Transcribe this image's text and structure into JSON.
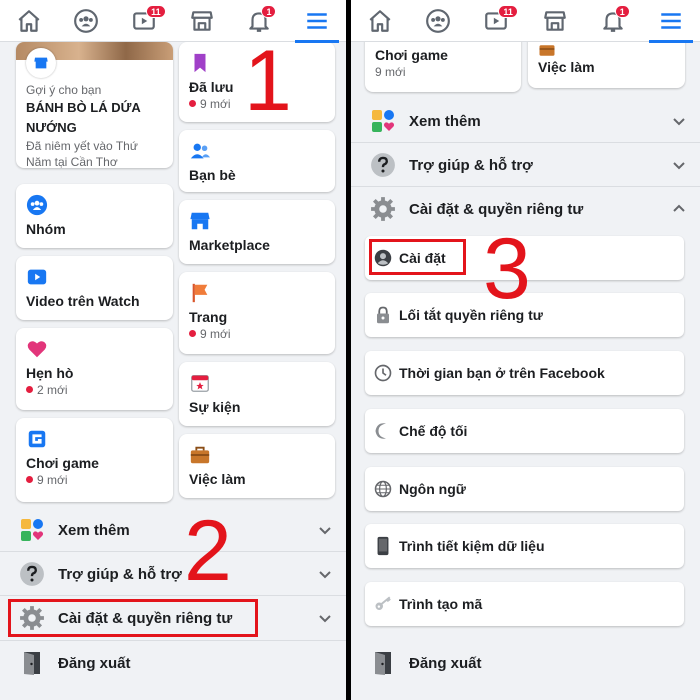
{
  "colors": {
    "accent": "#1877f2",
    "badge": "#e41e3f",
    "annotation": "#e3141b"
  },
  "nav": {
    "items": [
      {
        "icon": "home-icon"
      },
      {
        "icon": "groups-icon"
      },
      {
        "icon": "watch-icon",
        "badge": "11"
      },
      {
        "icon": "marketplace-icon"
      },
      {
        "icon": "bell-icon",
        "badge": "1"
      },
      {
        "icon": "menu-icon",
        "active": true
      }
    ]
  },
  "left": {
    "suggest": {
      "label": "Gợi ý cho bạn",
      "title": "BÁNH BÒ LÁ DỨA NƯỚNG",
      "desc": "Đã niêm yết vào Thứ Năm tại Cần Thơ"
    },
    "col_left": [
      {
        "title": "Nhóm",
        "icon": "groups-icon"
      },
      {
        "title": "Video trên Watch",
        "icon": "watch-icon"
      },
      {
        "title": "Hẹn hò",
        "sub": "2 mới",
        "icon": "heart-icon"
      },
      {
        "title": "Chơi game",
        "sub": "9 mới",
        "icon": "gaming-icon"
      }
    ],
    "col_right": [
      {
        "title": "Đã lưu",
        "sub": "9 mới",
        "icon": "bookmark-icon"
      },
      {
        "title": "Bạn bè",
        "icon": "friends-icon"
      },
      {
        "title": "Marketplace",
        "icon": "marketplace-icon"
      },
      {
        "title": "Trang",
        "sub": "9 mới",
        "icon": "flag-icon"
      },
      {
        "title": "Sự kiện",
        "icon": "calendar-icon"
      },
      {
        "title": "Việc làm",
        "icon": "briefcase-icon"
      }
    ],
    "rows": {
      "see_more": "Xem thêm",
      "help": "Trợ giúp & hỗ trợ",
      "settings": "Cài đặt & quyền riêng tư",
      "logout": "Đăng xuất"
    }
  },
  "right": {
    "top_cards": [
      {
        "title": "Chơi game",
        "sub": "9 mới"
      },
      {
        "title": "Việc làm"
      }
    ],
    "rows": {
      "see_more": "Xem thêm",
      "help": "Trợ giúp & hỗ trợ",
      "settings": "Cài đặt & quyền riêng tư",
      "logout": "Đăng xuất"
    },
    "settings_items": [
      {
        "label": "Cài đặt",
        "icon": "profile-icon"
      },
      {
        "label": "Lối tắt quyền riêng tư",
        "icon": "lock-icon"
      },
      {
        "label": "Thời gian bạn ở trên Facebook",
        "icon": "clock-icon"
      },
      {
        "label": "Chế độ tối",
        "icon": "moon-icon"
      },
      {
        "label": "Ngôn ngữ",
        "icon": "globe-icon"
      },
      {
        "label": "Trình tiết kiệm dữ liệu",
        "icon": "phone-icon"
      },
      {
        "label": "Trình tạo mã",
        "icon": "key-icon"
      }
    ]
  },
  "annotations": {
    "step1": "1",
    "step2": "2",
    "step3": "3"
  }
}
